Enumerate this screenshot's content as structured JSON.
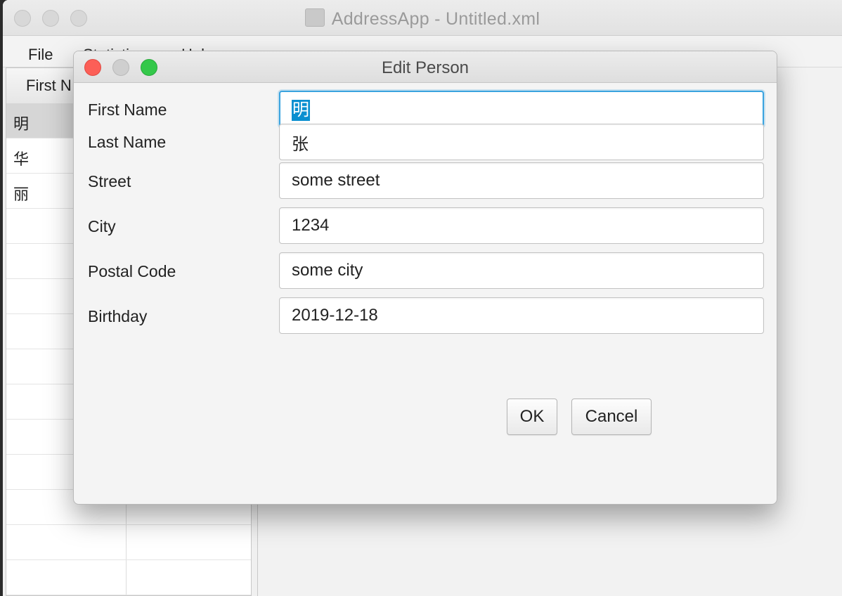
{
  "main_window": {
    "title": "AddressApp - Untitled.xml",
    "menu": [
      "File",
      "Statistics",
      "Help"
    ],
    "table": {
      "header_first": "First N",
      "rows": [
        "明",
        "华",
        "丽"
      ]
    }
  },
  "dialog": {
    "title": "Edit Person",
    "fields": [
      {
        "label": "First Name",
        "value": "明"
      },
      {
        "label": "Last Name",
        "value": "张"
      },
      {
        "label": "Street",
        "value": "some street"
      },
      {
        "label": "City",
        "value": "1234"
      },
      {
        "label": "Postal Code",
        "value": "some city"
      },
      {
        "label": "Birthday",
        "value": "2019-12-18"
      }
    ],
    "ok_label": "OK",
    "cancel_label": "Cancel"
  },
  "colors": {
    "focus": "#3aa3df",
    "selection": "#0a8fd0",
    "close": "#fc5f57",
    "zoom": "#34c84a"
  }
}
